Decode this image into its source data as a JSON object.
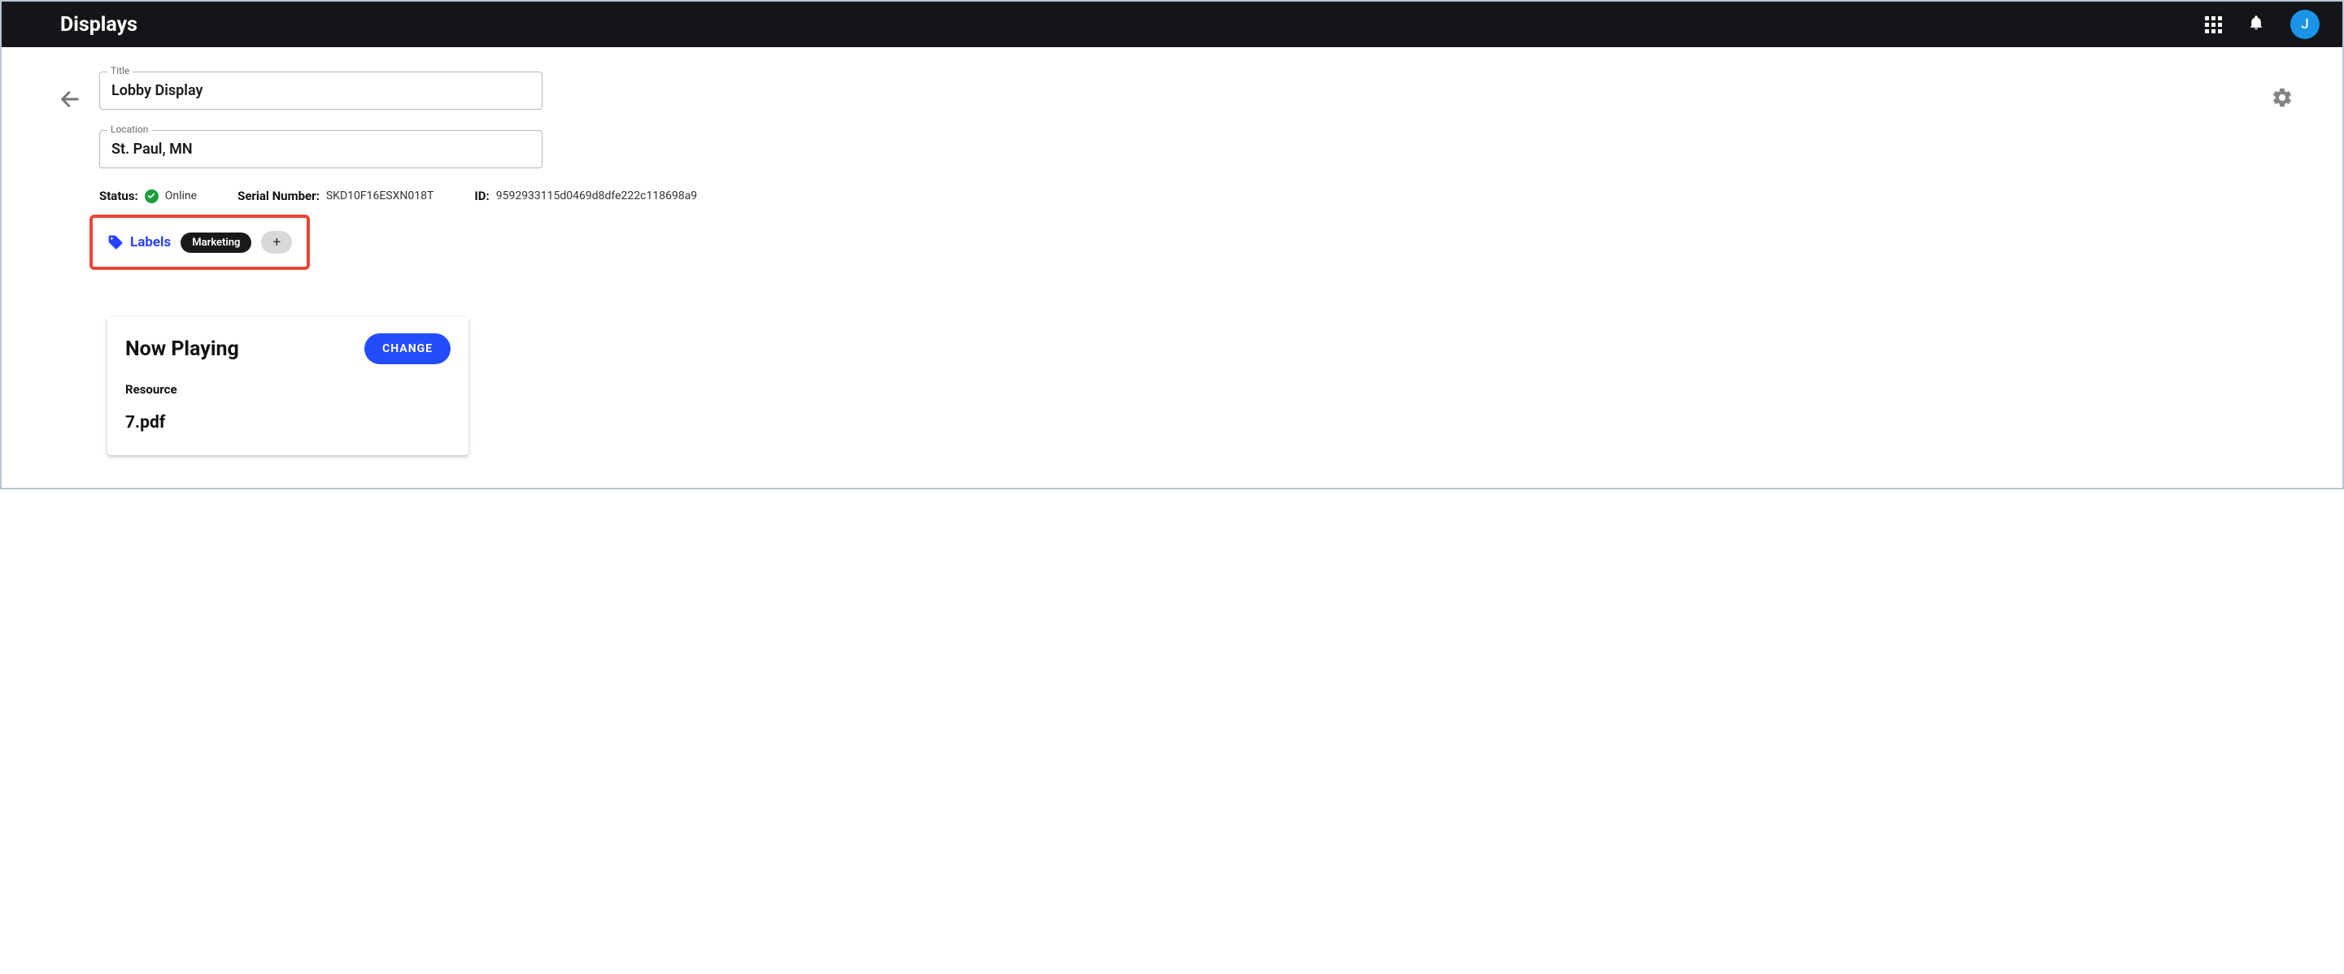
{
  "header": {
    "title": "Displays",
    "avatar_initial": "J"
  },
  "fields": {
    "title_label": "Title",
    "title_value": "Lobby Display",
    "location_label": "Location",
    "location_value": "St. Paul, MN"
  },
  "meta": {
    "status_label": "Status:",
    "status_value": "Online",
    "serial_label": "Serial Number:",
    "serial_value": "SKD10F16ESXN018T",
    "id_label": "ID:",
    "id_value": "9592933115d0469d8dfe222c118698a9"
  },
  "labels": {
    "link_text": "Labels",
    "chip": "Marketing",
    "add": "+"
  },
  "now_playing": {
    "title": "Now Playing",
    "change_label": "CHANGE",
    "resource_label": "Resource",
    "resource_value": "7.pdf"
  }
}
